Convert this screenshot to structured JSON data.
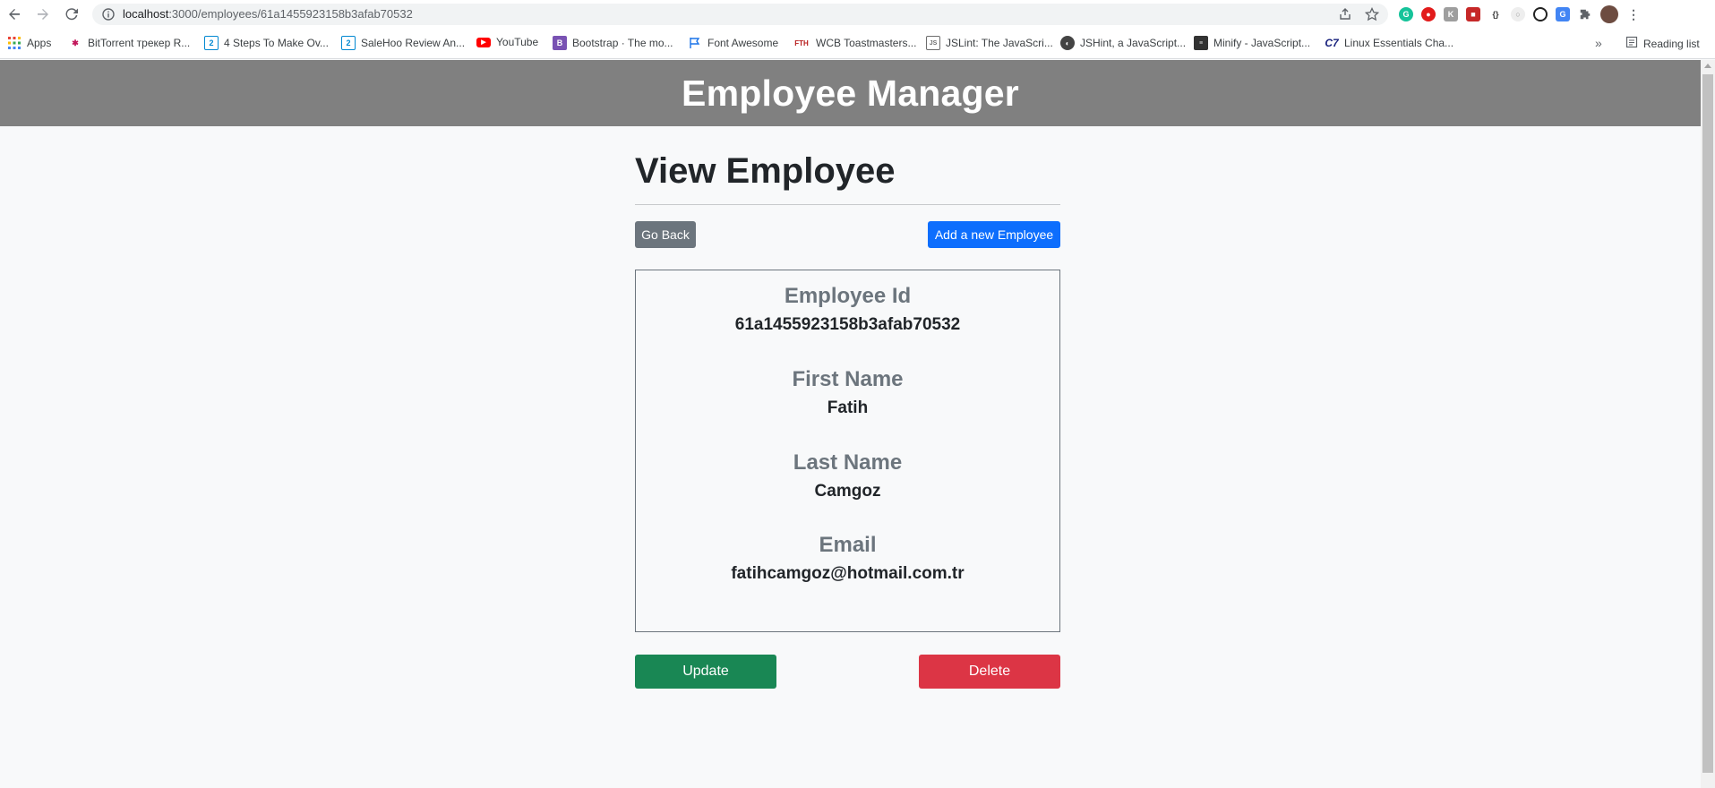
{
  "browser": {
    "url_host": "localhost",
    "url_path": ":3000/employees/61a1455923158b3afab70532",
    "bookmarks": [
      {
        "label": "Apps",
        "icon": "apps-grid-icon",
        "color": "#ea4335"
      },
      {
        "label": "BitTorrent трекер R...",
        "icon": "bittorrent-icon",
        "color": "#c2185b"
      },
      {
        "label": "4 Steps To Make Ov...",
        "icon": "salehoo-icon",
        "color": "#0288d1"
      },
      {
        "label": "SaleHoo Review An...",
        "icon": "salehoo-icon",
        "color": "#0288d1"
      },
      {
        "label": "YouTube",
        "icon": "youtube-icon",
        "color": "#ff0000"
      },
      {
        "label": "Bootstrap · The mo...",
        "icon": "bootstrap-icon",
        "color": "#7952b3"
      },
      {
        "label": "Font Awesome",
        "icon": "flag-icon",
        "color": "#1a73e8"
      },
      {
        "label": "WCB Toastmasters...",
        "icon": "fth-icon",
        "color": "#b71c1c"
      },
      {
        "label": "JSLint: The JavaScri...",
        "icon": "jslint-icon",
        "color": "#6d6d6d"
      },
      {
        "label": "JSHint, a JavaScript...",
        "icon": "globe-icon",
        "color": "#444"
      },
      {
        "label": "Minify - JavaScript...",
        "icon": "minify-icon",
        "color": "#333"
      },
      {
        "label": "Linux Essentials Cha...",
        "icon": "c7-icon",
        "color": "#1a237e"
      }
    ],
    "more": "»",
    "reading_list": "Reading list"
  },
  "header": {
    "title": "Employee Manager"
  },
  "view": {
    "title": "View Employee",
    "go_back": "Go Back",
    "add_new": "Add a new Employee",
    "fields": [
      {
        "label": "Employee Id",
        "value": "61a1455923158b3afab70532"
      },
      {
        "label": "First Name",
        "value": "Fatih"
      },
      {
        "label": "Last Name",
        "value": "Camgoz"
      },
      {
        "label": "Email",
        "value": "fatihcamgoz@hotmail.com.tr"
      }
    ],
    "update": "Update",
    "delete": "Delete"
  },
  "colors": {
    "header_bg": "#808080",
    "go_back": "#6c757d",
    "add_new": "#0d6efd",
    "update": "#198754",
    "delete": "#dc3545"
  }
}
